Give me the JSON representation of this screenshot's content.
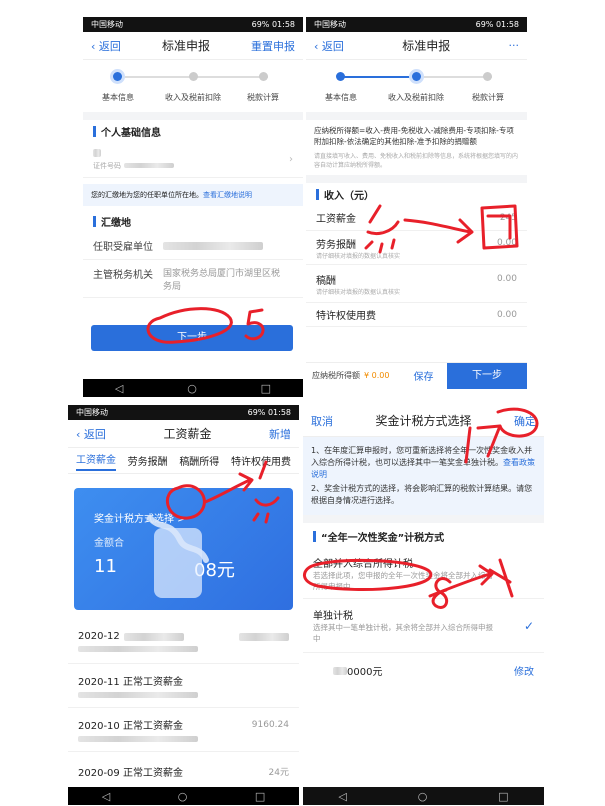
{
  "status": {
    "carrier": "中国移动",
    "battery": "69%",
    "time": "01:58"
  },
  "p1": {
    "back": "返回",
    "title": "标准申报",
    "reset": "重置申报",
    "steps": [
      "基本信息",
      "收入及税前扣除",
      "税款计算"
    ],
    "personal_title": "个人基础信息",
    "id_label": "证件号码",
    "notice": "您的汇缴地为您的任职单位所在地。",
    "notice_link": "查看汇缴地说明",
    "place_title": "汇缴地",
    "employer_label": "任职受雇单位",
    "authority_label": "主管税务机关",
    "authority_value": "国家税务总局厦门市湖里区税务局",
    "next": "下一步"
  },
  "p2": {
    "back": "返回",
    "title": "标准申报",
    "more": "···",
    "steps": [
      "基本信息",
      "收入及税前扣除",
      "税款计算"
    ],
    "formula": "应纳税所得额=收入-费用-免税收入-减除费用-专项扣除-专项附加扣除-依法确定的其他扣除-准予扣除的捐赠额",
    "hint": "请直接填写收入、费用、免税收入和税前扣除等信息，系统将根据您填写的内容自动计算应纳税所得额。",
    "income_title": "收入（元）",
    "rows": [
      {
        "label": "工资薪金",
        "value": "245"
      },
      {
        "label": "劳务报酬",
        "value": "0.00",
        "sub": "请仔细核对填报的数据认真核实"
      },
      {
        "label": "稿酬",
        "value": "0.00",
        "sub": "请仔细核对填报的数据认真核实"
      },
      {
        "label": "特许权使用费",
        "value": "0.00"
      }
    ],
    "taxable_label": "应纳税所得额",
    "taxable_value": "¥ 0.00",
    "save": "保存",
    "next": "下一步"
  },
  "p3": {
    "back": "返回",
    "title": "工资薪金",
    "add": "新增",
    "tabs": [
      "工资薪金",
      "劳务报酬",
      "稿酬所得",
      "特许权使用费"
    ],
    "bonus_link": "奖金计税方式选择 >",
    "amount_label": "金额合",
    "amount_prefix": "11",
    "amount_suffix": "08元",
    "items": [
      {
        "title": "2020-12",
        "amount": ""
      },
      {
        "title": "2020-11 正常工资薪金",
        "amount": ""
      },
      {
        "title": "2020-10 正常工资薪金",
        "amount": "9160.24"
      },
      {
        "title": "2020-09 正常工资薪金",
        "amount": "24元"
      }
    ]
  },
  "p4": {
    "cancel": "取消",
    "title": "奖金计税方式选择",
    "confirm": "确定",
    "info1": "1、在年度汇算申报时，您可重新选择将全年一次性奖金收入并入综合所得计税，也可以选择其中一笔奖金单独计税。",
    "info1_link": "查看政策说明",
    "info2": "2、奖金计税方式的选择，将会影响汇算的税款计算结果。请您根据自身情况进行选择。",
    "section": "“全年一次性奖金”计税方式",
    "opt1_title": "全部并入综合所得计税",
    "opt1_desc": "若选择此项，您申报的全年一次性奖金将全部并入综合所得申报中",
    "opt2_title": "单独计税",
    "opt2_desc": "选择其中一笔单独计税，其余将全部并入综合所得申报中",
    "amount": "0000元",
    "edit": "修改"
  }
}
